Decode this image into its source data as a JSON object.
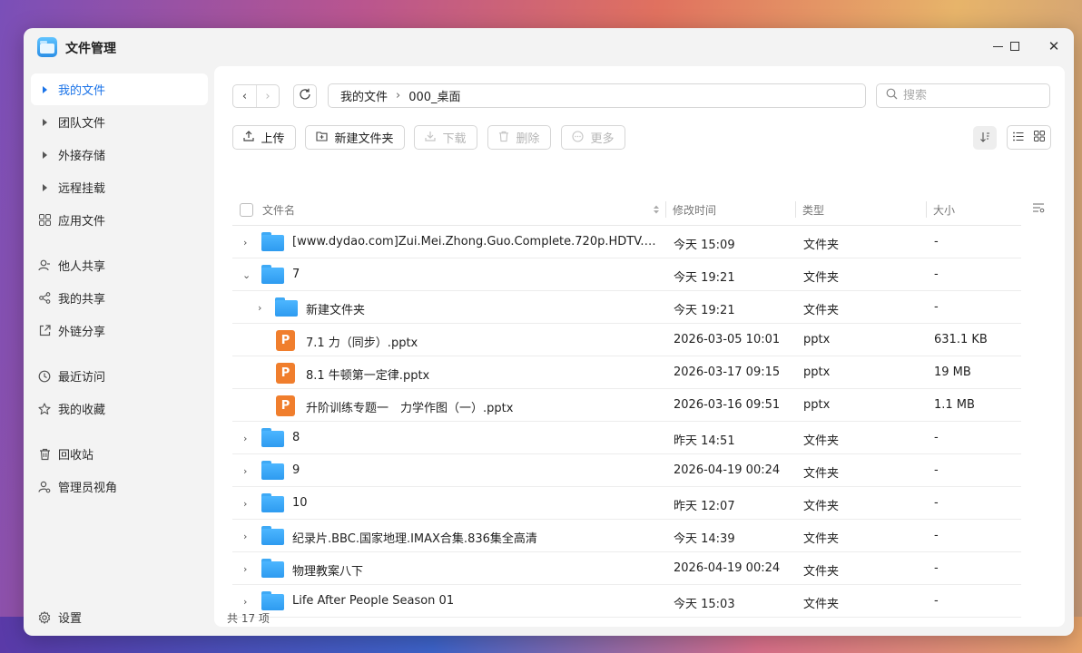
{
  "app": {
    "title": "文件管理"
  },
  "sidebar": {
    "items": [
      {
        "label": "我的文件",
        "icon": "caret-right-icon"
      },
      {
        "label": "团队文件",
        "icon": "caret-right-icon"
      },
      {
        "label": "外接存储",
        "icon": "caret-right-icon"
      },
      {
        "label": "远程挂载",
        "icon": "caret-right-icon"
      },
      {
        "label": "应用文件",
        "icon": "apps-icon"
      },
      {
        "label": "他人共享",
        "icon": "user-share-icon"
      },
      {
        "label": "我的共享",
        "icon": "share-icon"
      },
      {
        "label": "外链分享",
        "icon": "external-link-icon"
      },
      {
        "label": "最近访问",
        "icon": "clock-icon"
      },
      {
        "label": "我的收藏",
        "icon": "star-icon"
      },
      {
        "label": "回收站",
        "icon": "trash-icon"
      },
      {
        "label": "管理员视角",
        "icon": "admin-icon"
      }
    ],
    "settings_label": "设置"
  },
  "pathbar": {
    "root": "我的文件",
    "current": "000_桌面"
  },
  "search": {
    "placeholder": "搜索"
  },
  "toolbar": {
    "upload": "上传",
    "new_folder": "新建文件夹",
    "download": "下载",
    "delete": "删除",
    "more": "更多"
  },
  "table": {
    "headers": {
      "name": "文件名",
      "modified": "修改时间",
      "type": "类型",
      "size": "大小"
    },
    "rows": [
      {
        "name": "[www.dydao.com]Zui.Mei.Zhong.Guo.Complete.720p.HDTV.X...",
        "modified": "今天 15:09",
        "type": "文件夹",
        "size": "-"
      },
      {
        "name": "7",
        "modified": "今天 19:21",
        "type": "文件夹",
        "size": "-"
      },
      {
        "name": "新建文件夹",
        "modified": "今天 19:21",
        "type": "文件夹",
        "size": "-"
      },
      {
        "name": "7.1 力（同步）.pptx",
        "modified": "2026-03-05 10:01",
        "type": "pptx",
        "size": "631.1 KB",
        "icon_letter": "P"
      },
      {
        "name": "8.1 牛顿第一定律.pptx",
        "modified": "2026-03-17 09:15",
        "type": "pptx",
        "size": "19 MB",
        "icon_letter": "P"
      },
      {
        "name": "升阶训练专题一　力学作图（一）.pptx",
        "modified": "2026-03-16 09:51",
        "type": "pptx",
        "size": "1.1 MB",
        "icon_letter": "P"
      },
      {
        "name": "8",
        "modified": "昨天 14:51",
        "type": "文件夹",
        "size": "-"
      },
      {
        "name": "9",
        "modified": "2026-04-19 00:24",
        "type": "文件夹",
        "size": "-"
      },
      {
        "name": "10",
        "modified": "昨天 12:07",
        "type": "文件夹",
        "size": "-"
      },
      {
        "name": "纪录片.BBC.国家地理.IMAX合集.836集全高清",
        "modified": "今天 14:39",
        "type": "文件夹",
        "size": "-"
      },
      {
        "name": "物理教案八下",
        "modified": "2026-04-19 00:24",
        "type": "文件夹",
        "size": "-"
      },
      {
        "name": "Life After People Season 01",
        "modified": "今天 15:03",
        "type": "文件夹",
        "size": "-"
      }
    ]
  },
  "status": {
    "count": "共 17 项"
  },
  "colors": {
    "accent": "#1a73e8",
    "folder": "#2e9bf0",
    "pptx": "#f07e2d"
  }
}
